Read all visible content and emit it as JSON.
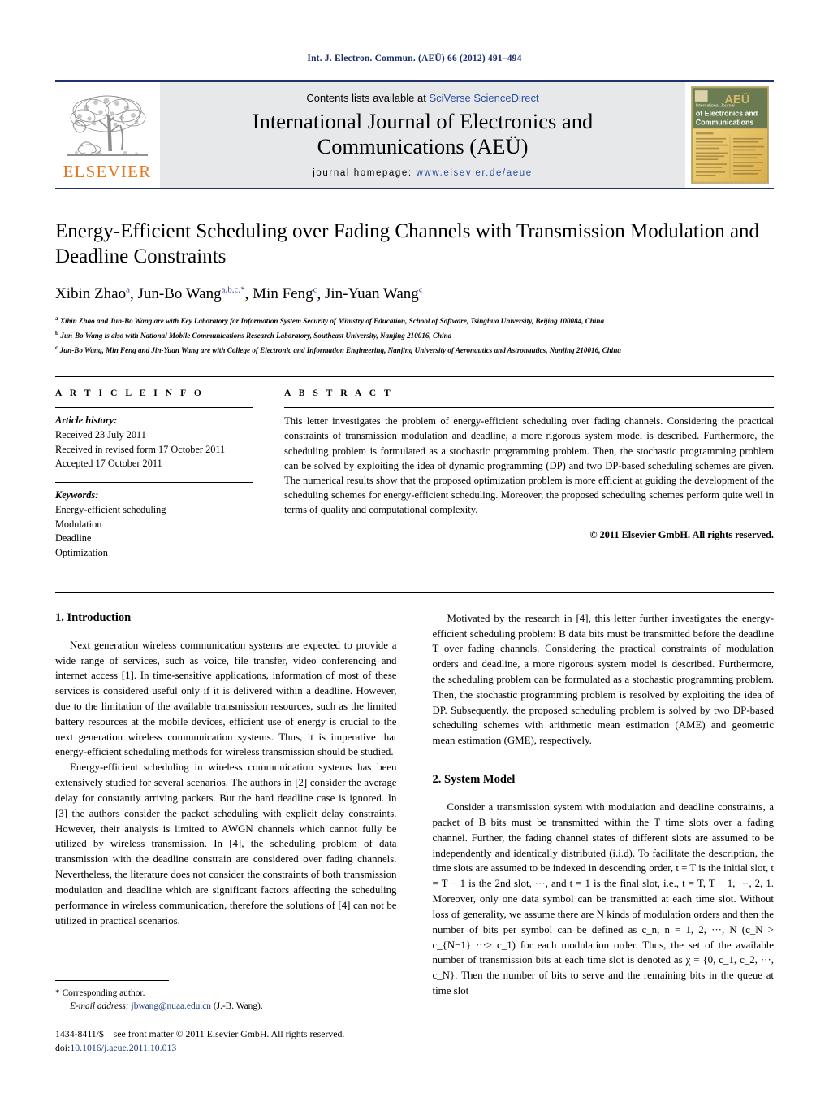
{
  "running_head": "Int. J. Electron. Commun. (AEÜ) 66 (2012) 491–494",
  "masthead": {
    "contents_prefix": "Contents lists available at ",
    "sciencedirect": "SciVerse ScienceDirect",
    "journal_title": "International Journal of Electronics and Communications (AEÜ)",
    "homepage_label": "journal homepage:",
    "homepage_url": "www.elsevier.de/aeue",
    "publisher_wordmark": "ELSEVIER",
    "cover_title_line1": "International Journal",
    "cover_title_line2": "of Electronics and",
    "cover_title_line3": "Communications",
    "cover_badge": "AEÜ",
    "colors": {
      "rule": "#23306e",
      "panel": "#e7e8ea",
      "link": "#2a4d9e",
      "elsevier_orange": "#e87722"
    }
  },
  "title_block": {
    "title": "Energy-Efficient Scheduling over Fading Channels with Transmission Modulation and Deadline Constraints",
    "authors": [
      {
        "name": "Xibin Zhao",
        "marks": "a"
      },
      {
        "name": "Jun-Bo Wang",
        "marks": "a,b,c,*"
      },
      {
        "name": "Min Feng",
        "marks": "c"
      },
      {
        "name": "Jin-Yuan Wang",
        "marks": "c"
      }
    ],
    "affiliations": [
      {
        "mark": "a",
        "text": "Xibin Zhao and Jun-Bo Wang are with Key Laboratory for Information System Security of Ministry of Education, School of Software, Tsinghua University, Beijing 100084, China"
      },
      {
        "mark": "b",
        "text": "Jun-Bo Wang is also with National Mobile Communications Research Laboratory, Southeast University, Nanjing 210016, China"
      },
      {
        "mark": "c",
        "text": "Jun-Bo Wang, Min Feng and Jin-Yuan Wang are with College of Electronic and Information Engineering, Nanjing University of Aeronautics and Astronautics, Nanjing 210016, China"
      }
    ]
  },
  "article_info": {
    "heading": "A R T I C L E    I N F O",
    "history_label": "Article history:",
    "history": [
      "Received 23 July 2011",
      "Received in revised form 17 October 2011",
      "Accepted 17 October 2011"
    ],
    "keywords_label": "Keywords:",
    "keywords": [
      "Energy-efficient scheduling",
      "Modulation",
      "Deadline",
      "Optimization"
    ]
  },
  "abstract": {
    "heading": "A B S T R A C T",
    "text": "This letter investigates the problem of energy-efficient scheduling over fading channels. Considering the practical constraints of transmission modulation and deadline, a more rigorous system model is described. Furthermore, the scheduling problem is formulated as a stochastic programming problem. Then, the stochastic programming problem can be solved by exploiting the idea of dynamic programming (DP) and two DP-based scheduling schemes are given. The numerical results show that the proposed optimization problem is more efficient at guiding the development of the scheduling schemes for energy-efficient scheduling. Moreover, the proposed scheduling schemes perform quite well in terms of quality and computational complexity.",
    "copyright": "© 2011 Elsevier GmbH. All rights reserved."
  },
  "sections": {
    "introduction": {
      "heading": "1.  Introduction",
      "paragraphs": [
        "Next generation wireless communication systems are expected to provide a wide range of services, such as voice, file transfer, video conferencing and internet access [1]. In time-sensitive applications, information of most of these services is considered useful only if it is delivered within a deadline. However, due to the limitation of the available transmission resources, such as the limited battery resources at the mobile devices, efficient use of energy is crucial to the next generation wireless communication systems. Thus, it is imperative that energy-efficient scheduling methods for wireless transmission should be studied.",
        "Energy-efficient scheduling in wireless communication systems has been extensively studied for several scenarios. The authors in [2] consider the average delay for constantly arriving packets. But the hard deadline case is ignored. In [3] the authors consider the packet scheduling with explicit delay constraints. However, their analysis is limited to AWGN channels which cannot fully be utilized by wireless transmission. In [4], the scheduling problem of data transmission with the deadline constrain are considered over fading channels. Nevertheless, the literature does not consider the constraints of both transmission modulation and deadline which are significant factors affecting the scheduling performance in wireless communication, therefore the solutions of [4] can not be utilized in practical scenarios.",
        "Motivated by the research in [4], this letter further investigates the energy-efficient scheduling problem: B data bits must be transmitted before the deadline T over fading channels. Considering the practical constraints of modulation orders and deadline, a more rigorous system model is described. Furthermore, the scheduling problem can be formulated as a stochastic programming problem. Then, the stochastic programming problem is resolved by exploiting the idea of DP. Subsequently, the proposed scheduling problem is solved by two DP-based scheduling schemes with arithmetic mean estimation (AME) and geometric mean estimation (GME), respectively."
      ]
    },
    "system_model": {
      "heading": "2.  System Model",
      "paragraphs": [
        "Consider a transmission system with modulation and deadline constraints, a packet of B bits must be transmitted within the T time slots over a fading channel. Further, the fading channel states of different slots are assumed to be independently and identically distributed (i.i.d). To facilitate the description, the time slots are assumed to be indexed in descending order, t = T is the initial slot, t = T − 1 is the 2nd slot, ···, and t = 1 is the final slot, i.e., t = T, T − 1, ···, 2, 1. Moreover, only one data symbol can be transmitted at each time slot. Without loss of generality, we assume there are N kinds of modulation orders and then the number of bits per symbol can be defined as c_n, n = 1, 2, ···, N (c_N > c_{N−1} ···> c_1) for each modulation order. Thus, the set of the available number of transmission bits at each time slot is denoted as χ = {0, c_1, c_2, ···, c_N}. Then the number of bits to serve and the remaining bits in the queue at time slot"
      ]
    }
  },
  "footer": {
    "corresponding_marker": "*",
    "corresponding_text": "Corresponding author.",
    "email_label": "E-mail address:",
    "email_address": "jbwang@nuaa.edu.cn",
    "email_person": "(J.-B. Wang).",
    "frontmatter": "1434-8411/$ – see front matter © 2011 Elsevier GmbH. All rights reserved.",
    "doi_label": "doi:",
    "doi_value": "10.1016/j.aeue.2011.10.013"
  }
}
